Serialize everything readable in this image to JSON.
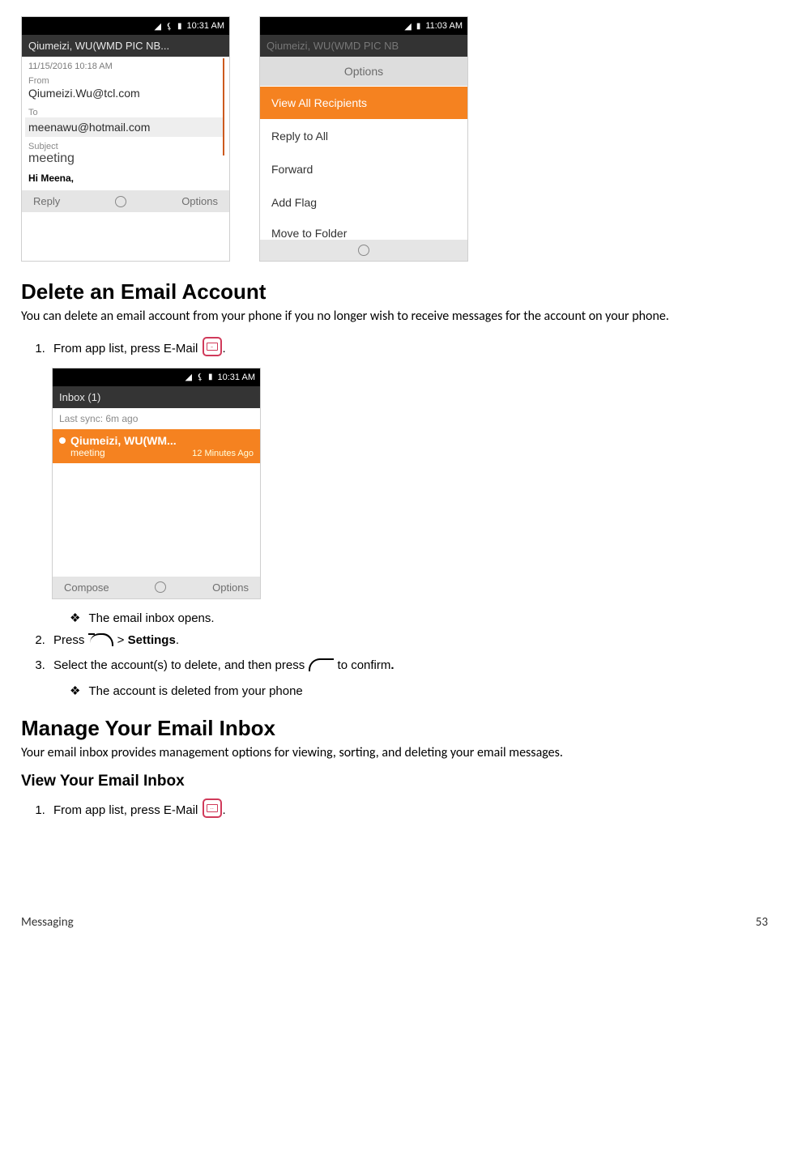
{
  "phone1": {
    "time": "10:31 AM",
    "header": "Qiumeizi, WU(WMD PIC NB...",
    "timestamp": "11/15/2016 10:18 AM",
    "from_label": "From",
    "from": "Qiumeizi.Wu@tcl.com",
    "to_label": "To",
    "to": "meenawu@hotmail.com",
    "subject_label": "Subject",
    "subject": "meeting",
    "greeting": "Hi Meena,",
    "reply": "Reply",
    "options": "Options"
  },
  "phone2": {
    "time": "11:03 AM",
    "faded_header": "Qiumeizi, WU(WMD PIC NB",
    "options_title": "Options",
    "items": {
      "view_all": "View All Recipients",
      "reply_all": "Reply to All",
      "forward": "Forward",
      "add_flag": "Add Flag",
      "move": "Move to Folder"
    }
  },
  "phone3": {
    "time": "10:31 AM",
    "header": "Inbox (1)",
    "sync": "Last sync: 6m ago",
    "sender": "Qiumeizi, WU(WM...",
    "subject": "meeting",
    "ago": "12 Minutes Ago",
    "compose": "Compose",
    "options": "Options"
  },
  "doc": {
    "h1_delete": "Delete an Email Account",
    "delete_intro": "You can delete an email account from your phone if you no longer wish to receive messages for the account on your phone.",
    "step1a": "From app list, press E-Mail ",
    "step1b": ".",
    "sub_inbox": "The email inbox opens.",
    "step2a": "Press ",
    "step2b": " > ",
    "step2c": "Settings",
    "step2d": ".",
    "step3a": "Select the account(s) to delete, and then press ",
    "step3b": " to confirm",
    "step3c": ".",
    "sub_deleted": "The account is deleted from your phone",
    "h1_manage": "Manage Your Email Inbox",
    "manage_intro": "Your email inbox provides management options for viewing, sorting, and deleting your email messages.",
    "h2_view": "View Your Email Inbox",
    "view_step1a": "From app list, press E-Mail ",
    "view_step1b": "."
  },
  "footer": {
    "section": "Messaging",
    "page": "53"
  }
}
